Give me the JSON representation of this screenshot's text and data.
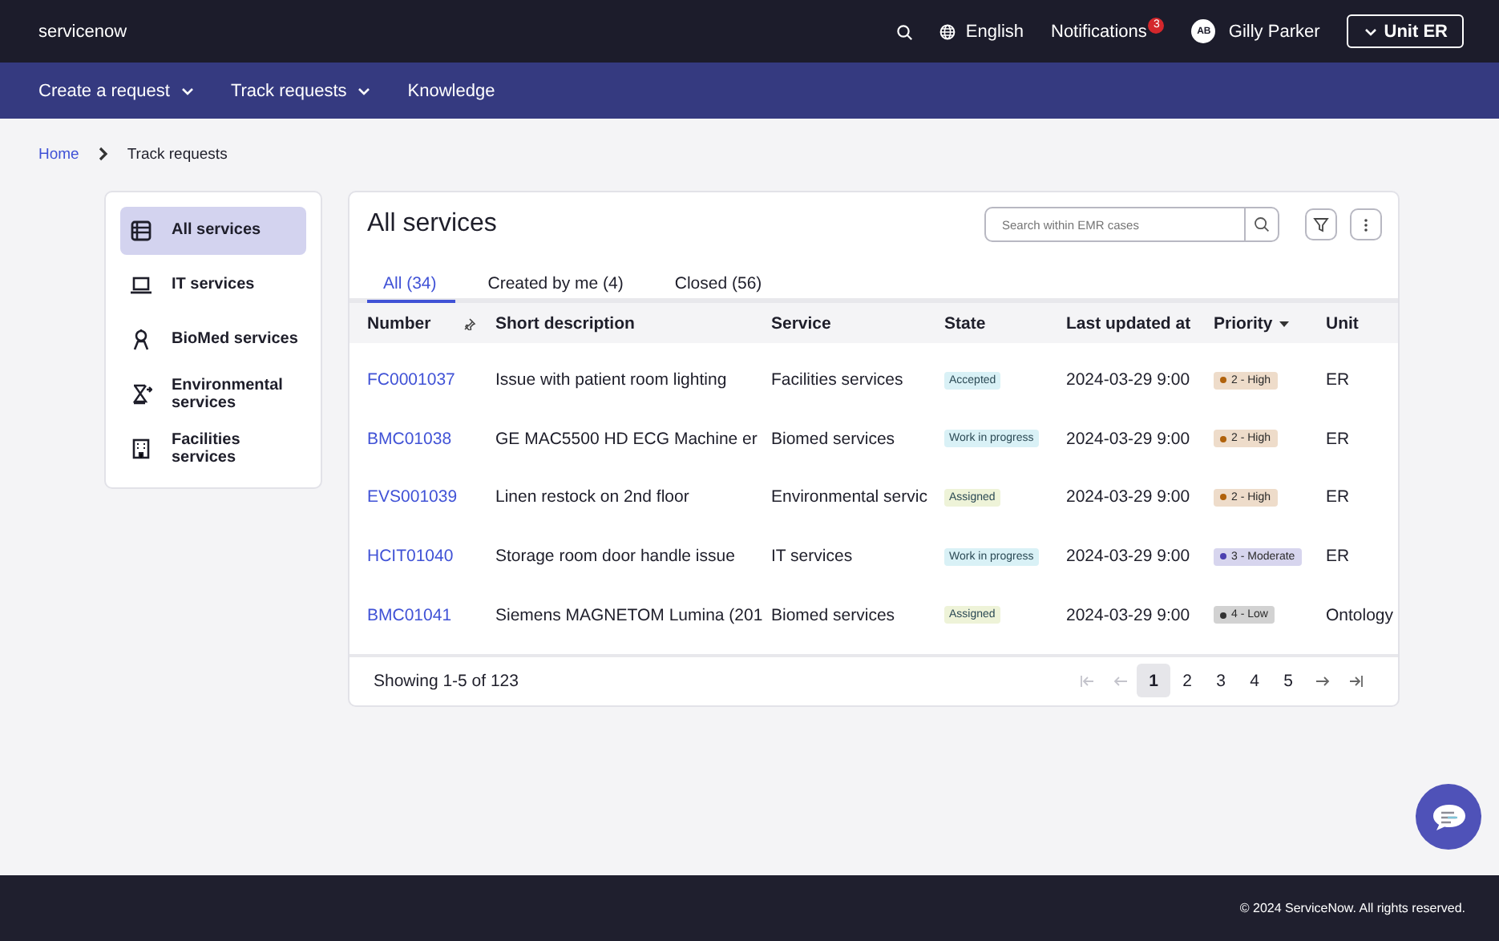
{
  "header": {
    "logo": "servicenow",
    "language": "English",
    "notifications": {
      "label": "Notifications",
      "count": "3"
    },
    "user": {
      "initials": "AB",
      "name": "Gilly Parker"
    },
    "unit_button": "Unit ER"
  },
  "nav": [
    {
      "label": "Create a request",
      "has_menu": true
    },
    {
      "label": "Track requests",
      "has_menu": true
    },
    {
      "label": "Knowledge",
      "has_menu": false
    }
  ],
  "breadcrumb": [
    "Home",
    "Track requests"
  ],
  "sidebar": {
    "items": [
      {
        "label": "All services",
        "selected": true
      },
      {
        "label": "IT services",
        "selected": false
      },
      {
        "label": "BioMed services",
        "selected": false
      },
      {
        "label": "Environmental services",
        "selected": false
      },
      {
        "label": "Facilities services",
        "selected": false
      }
    ]
  },
  "main": {
    "title": "All services",
    "search": {
      "placeholder": "Search within EMR cases"
    },
    "tabs": [
      {
        "label": "All (34)",
        "selected": true
      },
      {
        "label": "Created by me (4)",
        "selected": false
      },
      {
        "label": "Closed (56)",
        "selected": false
      }
    ],
    "table": {
      "columns": [
        {
          "label": "Number",
          "pinned": true,
          "sorted": false
        },
        {
          "label": "Short description",
          "pinned": false,
          "sorted": false
        },
        {
          "label": "Service",
          "pinned": false,
          "sorted": false
        },
        {
          "label": "State",
          "pinned": false,
          "sorted": false
        },
        {
          "label": "Last updated at",
          "pinned": false,
          "sorted": false
        },
        {
          "label": "Priority",
          "pinned": false,
          "sorted": true
        },
        {
          "label": "Unit",
          "pinned": false,
          "sorted": false
        }
      ],
      "rows": [
        {
          "number": "FC0001037",
          "description": "Issue with patient room lighting",
          "service": "Facilities services",
          "state": {
            "label": "Accepted",
            "color": "#d9f1f6"
          },
          "updated": "2024-03-29 9:00",
          "priority": {
            "label": "2 - High",
            "color": "#b0620c"
          },
          "unit": "ER"
        },
        {
          "number": "BMC01038",
          "description": "GE MAC5500 HD ECG Machine er",
          "service": "Biomed services",
          "state": {
            "label": "Work in progress",
            "color": "#d9f1f6"
          },
          "updated": "2024-03-29 9:00",
          "priority": {
            "label": "2 - High",
            "color": "#b0620c"
          },
          "unit": "ER"
        },
        {
          "number": "EVS001039",
          "description": "Linen restock on 2nd floor",
          "service": "Environmental servic",
          "state": {
            "label": "Assigned",
            "color": "#eef3d8"
          },
          "updated": "2024-03-29 9:00",
          "priority": {
            "label": "2 - High",
            "color": "#b0620c"
          },
          "unit": "ER"
        },
        {
          "number": "HCIT01040",
          "description": "Storage room door handle issue",
          "service": "IT services",
          "state": {
            "label": "Work in progress",
            "color": "#d9f1f6"
          },
          "updated": "2024-03-29 9:00",
          "priority": {
            "label": "3 - Moderate",
            "color": "#4b3fb0"
          },
          "unit": "ER"
        },
        {
          "number": "BMC01041",
          "description": "Siemens MAGNETOM Lumina (201",
          "service": "Biomed services",
          "state": {
            "label": "Assigned",
            "color": "#eef3d8"
          },
          "updated": "2024-03-29 9:00",
          "priority": {
            "label": "4 - Low",
            "color": "#333333"
          },
          "unit": "Ontology"
        }
      ]
    },
    "pagination": {
      "summary": "Showing 1-5 of 123",
      "first_disabled": true,
      "prev_disabled": true,
      "next_disabled": false,
      "last_disabled": false,
      "pages": [
        {
          "label": "1",
          "selected": true
        },
        {
          "label": "2",
          "selected": false
        },
        {
          "label": "3",
          "selected": false
        },
        {
          "label": "4",
          "selected": false
        },
        {
          "label": "5",
          "selected": false
        }
      ]
    }
  },
  "footer": {
    "copyright": "© 2024 ServiceNow. All rights reserved."
  }
}
